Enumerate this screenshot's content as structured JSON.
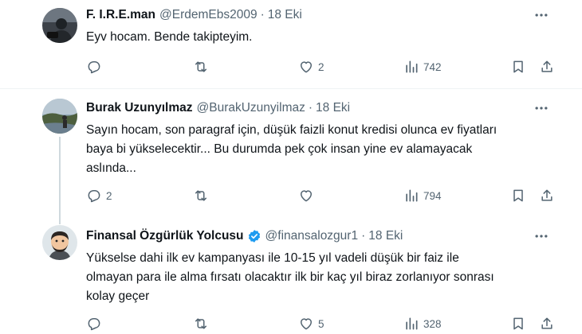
{
  "tweets": [
    {
      "name": "F. I.R.E.man",
      "handle": "@ErdemEbs2009",
      "dot": "·",
      "date": "18 Eki",
      "text": "Eyv hocam. Bende takipteyim.",
      "reply_count": "",
      "like_count": "2",
      "view_count": "742",
      "verified": false
    },
    {
      "name": "Burak Uzunyılmaz",
      "handle": "@BurakUzunyilmaz",
      "dot": "·",
      "date": "18 Eki",
      "text": "Sayın hocam, son paragraf için, düşük faizli konut kredisi olunca ev fiyatları\nbaya bi yükselecektir... Bu durumda pek çok insan yine ev alamayacak\naslında...",
      "reply_count": "2",
      "like_count": "",
      "view_count": "794",
      "verified": false
    },
    {
      "name": "Finansal Özgürlük Yolcusu",
      "handle": "@finansalozgur1",
      "dot": "·",
      "date": "18 Eki",
      "text": "Yükselse dahi ilk ev kampanyası ile 10-15 yıl vadeli düşük bir faiz ile\nolmayan para ile alma fırsatı olacaktır ilk bir kaç yıl biraz zorlanıyor sonrası\nkolay geçer",
      "reply_count": "",
      "like_count": "5",
      "view_count": "328",
      "verified": true
    }
  ],
  "icons": {
    "reply": "reply-icon",
    "retweet": "retweet-icon",
    "like": "like-icon",
    "views": "views-icon",
    "bookmark": "bookmark-icon",
    "share": "share-icon",
    "more": "more-icon",
    "verified": "verified-badge-icon"
  },
  "colors": {
    "text": "#0f1419",
    "secondary": "#536471",
    "divider": "#eff3f4",
    "verified": "#1d9bf0"
  }
}
